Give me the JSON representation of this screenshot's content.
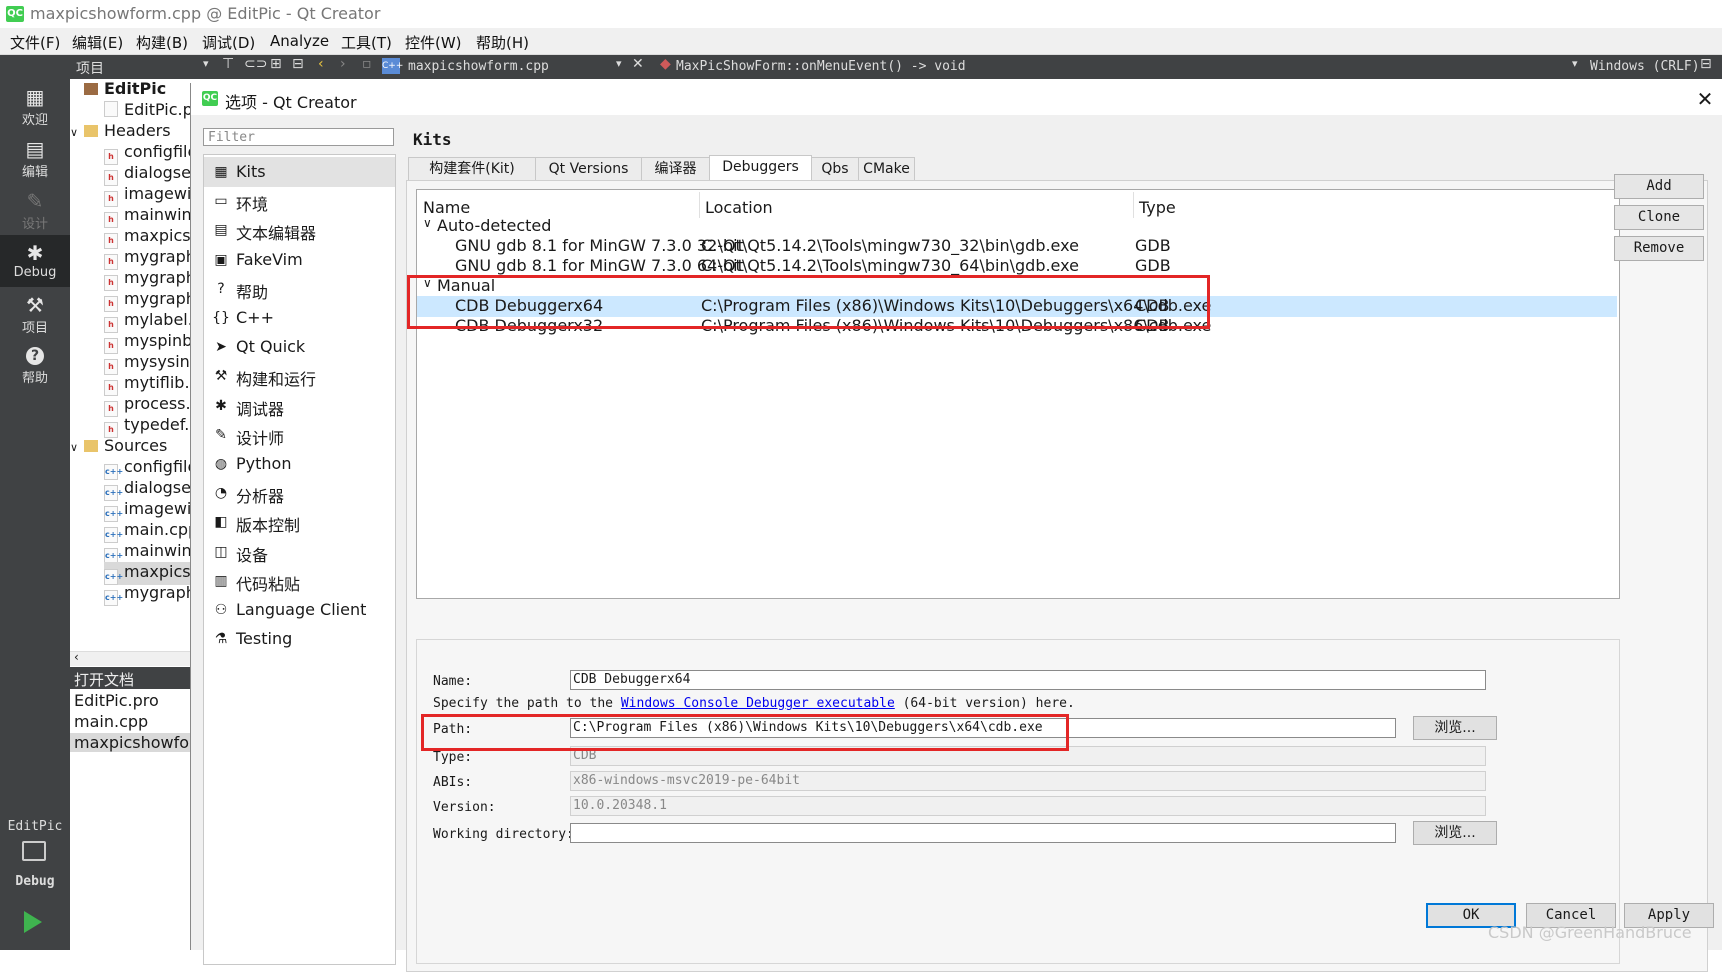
{
  "window": {
    "title": "maxpicshowform.cpp @ EditPic - Qt Creator",
    "logo": "QC"
  },
  "menubar": [
    "文件(F)",
    "编辑(E)",
    "构建(B)",
    "调试(D)",
    "Analyze",
    "工具(T)",
    "控件(W)",
    "帮助(H)"
  ],
  "editor_toolbar": {
    "panel_label": "项目",
    "file_name": "maxpicshowform.cpp",
    "function": "MaxPicShowForm::onMenuEvent() -> void",
    "line_ending": "Windows (CRLF)"
  },
  "modes": [
    {
      "label": "欢迎",
      "icon": "grid-icon"
    },
    {
      "label": "编辑",
      "icon": "edit-icon"
    },
    {
      "label": "设计",
      "icon": "pencil-icon"
    },
    {
      "label": "Debug",
      "icon": "bug-icon"
    },
    {
      "label": "项目",
      "icon": "wrench-icon"
    },
    {
      "label": "帮助",
      "icon": "help-icon"
    }
  ],
  "kit_selector": {
    "project": "EditPic",
    "config": "Debug"
  },
  "project_tree": [
    {
      "label": "EditPic",
      "kind": "project",
      "indent": 0
    },
    {
      "label": "EditPic.pro",
      "kind": "pro",
      "indent": 1
    },
    {
      "label": "Headers",
      "kind": "folder",
      "indent": 0
    },
    {
      "label": "configfile.h",
      "kind": "h",
      "indent": 1
    },
    {
      "label": "dialogset.h",
      "kind": "h",
      "indent": 1
    },
    {
      "label": "imagewidget.h",
      "kind": "h",
      "indent": 1
    },
    {
      "label": "mainwindow.h",
      "kind": "h",
      "indent": 1
    },
    {
      "label": "maxpicshowform.h",
      "kind": "h",
      "indent": 1
    },
    {
      "label": "mygraphicsview.h",
      "kind": "h",
      "indent": 1
    },
    {
      "label": "mygraphicsscene.h",
      "kind": "h",
      "indent": 1
    },
    {
      "label": "mygraphicsitem.h",
      "kind": "h",
      "indent": 1
    },
    {
      "label": "mylabel.h",
      "kind": "h",
      "indent": 1
    },
    {
      "label": "myspinbox.h",
      "kind": "h",
      "indent": 1
    },
    {
      "label": "mysysinfo.h",
      "kind": "h",
      "indent": 1
    },
    {
      "label": "mytiflib.h",
      "kind": "h",
      "indent": 1
    },
    {
      "label": "process.h",
      "kind": "h",
      "indent": 1
    },
    {
      "label": "typedef.h",
      "kind": "h",
      "indent": 1
    },
    {
      "label": "Sources",
      "kind": "folder",
      "indent": 0
    },
    {
      "label": "configfile.cpp",
      "kind": "cpp",
      "indent": 1
    },
    {
      "label": "dialogset.cpp",
      "kind": "cpp",
      "indent": 1
    },
    {
      "label": "imagewidget.cpp",
      "kind": "cpp",
      "indent": 1
    },
    {
      "label": "main.cpp",
      "kind": "cpp",
      "indent": 1
    },
    {
      "label": "mainwindow.cpp",
      "kind": "cpp",
      "indent": 1
    },
    {
      "label": "maxpicshowform.cpp",
      "kind": "cpp",
      "indent": 1
    },
    {
      "label": "mygraphicsview.cpp",
      "kind": "cpp",
      "indent": 1
    }
  ],
  "open_docs": {
    "title": "打开文档",
    "items": [
      "EditPic.pro",
      "main.cpp",
      "maxpicshowform.cpp"
    ]
  },
  "dialog": {
    "title": "选项 - Qt Creator",
    "filter_placeholder": "Filter",
    "page_title": "Kits",
    "categories": [
      {
        "label": "Kits",
        "icon": "kits-icon",
        "glyph": "▦"
      },
      {
        "label": "环境",
        "icon": "monitor-icon",
        "glyph": "▭"
      },
      {
        "label": "文本编辑器",
        "icon": "text-editor-icon",
        "glyph": "▤"
      },
      {
        "label": "FakeVim",
        "icon": "fakevim-icon",
        "glyph": "▣"
      },
      {
        "label": "帮助",
        "icon": "help-icon",
        "glyph": "?"
      },
      {
        "label": "C++",
        "icon": "cpp-icon",
        "glyph": "{}"
      },
      {
        "label": "Qt Quick",
        "icon": "qtquick-icon",
        "glyph": "➤"
      },
      {
        "label": "构建和运行",
        "icon": "hammer-icon",
        "glyph": "⚒"
      },
      {
        "label": "调试器",
        "icon": "bug-icon",
        "glyph": "✱"
      },
      {
        "label": "设计师",
        "icon": "pen-icon",
        "glyph": "✎"
      },
      {
        "label": "Python",
        "icon": "python-icon",
        "glyph": "◍"
      },
      {
        "label": "分析器",
        "icon": "analyzer-icon",
        "glyph": "◔"
      },
      {
        "label": "版本控制",
        "icon": "version-control-icon",
        "glyph": "◧"
      },
      {
        "label": "设备",
        "icon": "device-icon",
        "glyph": "◫"
      },
      {
        "label": "代码粘贴",
        "icon": "clipboard-icon",
        "glyph": "▥"
      },
      {
        "label": "Language Client",
        "icon": "language-client-icon",
        "glyph": "⚇"
      },
      {
        "label": "Testing",
        "icon": "testing-icon",
        "glyph": "⚗"
      }
    ],
    "tabs": [
      "构建套件(Kit)",
      "Qt Versions",
      "编译器",
      "Debuggers",
      "Qbs",
      "CMake"
    ],
    "active_tab": "Debuggers",
    "debuggers_table": {
      "columns": [
        "Name",
        "Location",
        "Type"
      ],
      "groups": [
        {
          "label": "Auto-detected",
          "items": [
            {
              "name": "GNU gdb 8.1 for MinGW 7.3.0 32-bit",
              "location": "C:\\Qt\\Qt5.14.2\\Tools\\mingw730_32\\bin\\gdb.exe",
              "type": "GDB"
            },
            {
              "name": "GNU gdb 8.1 for MinGW 7.3.0 64-bit",
              "location": "C:\\Qt\\Qt5.14.2\\Tools\\mingw730_64\\bin\\gdb.exe",
              "type": "GDB"
            }
          ]
        },
        {
          "label": "Manual",
          "items": [
            {
              "name": "CDB Debuggerx64",
              "location": "C:\\Program Files (x86)\\Windows Kits\\10\\Debuggers\\x64\\cdb.exe",
              "type": "CDB"
            },
            {
              "name": "CDB Debuggerx32",
              "location": "C:\\Program Files (x86)\\Windows Kits\\10\\Debuggers\\x86\\cdb.exe",
              "type": "CDB"
            }
          ]
        }
      ]
    },
    "side_buttons": {
      "add": "Add",
      "clone": "Clone",
      "remove": "Remove"
    },
    "details": {
      "name_label": "Name:",
      "name_value": "CDB Debuggerx64",
      "hint_prefix": "Specify the path to the ",
      "hint_link": "Windows Console Debugger executable",
      "hint_suffix": " (64-bit version) here.",
      "path_label": "Path:",
      "path_value": "C:\\Program Files (x86)\\Windows Kits\\10\\Debuggers\\x64\\cdb.exe",
      "browse_label": "浏览...",
      "type_label": "Type:",
      "type_value": "CDB",
      "abis_label": "ABIs:",
      "abis_value": "x86-windows-msvc2019-pe-64bit",
      "version_label": "Version:",
      "version_value": "10.0.20348.1",
      "workdir_label": "Working directory:",
      "workdir_value": "",
      "browse2_label": "浏览..."
    },
    "footer": {
      "ok": "OK",
      "cancel": "Cancel",
      "apply": "Apply"
    }
  },
  "watermark": "CSDN @GreenHandBruce",
  "colors": {
    "accent": "#41cd52",
    "selection": "#cce8ff",
    "highlight_box": "#e32626",
    "mode_bar": "#404244"
  }
}
